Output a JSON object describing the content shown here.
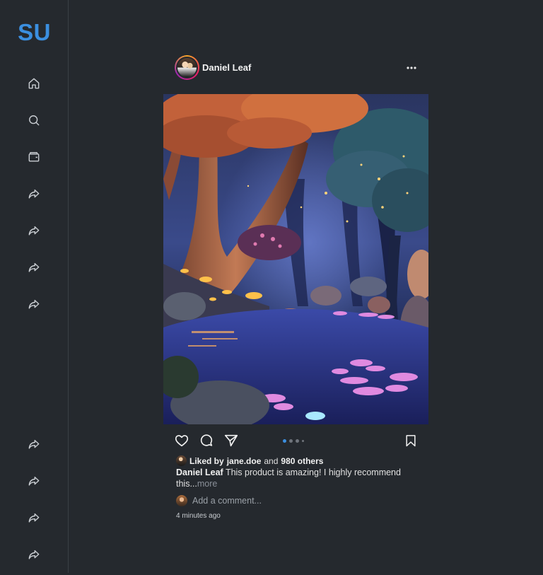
{
  "brand": {
    "logo_text": "SU",
    "color": "#3b8fe0"
  },
  "sidebar": {
    "top_items": [
      {
        "icon": "home-icon"
      },
      {
        "icon": "search-icon"
      },
      {
        "icon": "wallet-icon"
      },
      {
        "icon": "share-arrow-icon"
      },
      {
        "icon": "share-arrow-icon"
      },
      {
        "icon": "share-arrow-icon"
      },
      {
        "icon": "share-arrow-icon"
      }
    ],
    "bottom_items": [
      {
        "icon": "share-arrow-icon"
      },
      {
        "icon": "share-arrow-icon"
      },
      {
        "icon": "share-arrow-icon"
      },
      {
        "icon": "share-arrow-icon"
      }
    ]
  },
  "post": {
    "author": "Daniel Leaf",
    "image_alt": "Enchanted forest river at night with glowing mushrooms and pink lily pads",
    "carousel": {
      "total": 4,
      "active_index": 0
    },
    "likes": {
      "liked_by_prefix": "Liked by",
      "liked_by_user": "jane.doe",
      "and_text": "and",
      "others_text": "980 others"
    },
    "caption": {
      "author": "Daniel Leaf",
      "text": "This product is amazing! I highly recommend this...",
      "more_label": "more"
    },
    "comment_placeholder": "Add a comment...",
    "timestamp": "4 minutes ago"
  },
  "colors": {
    "background": "#25292e",
    "accent": "#3b8fe0",
    "text": "#e8e8e8"
  }
}
